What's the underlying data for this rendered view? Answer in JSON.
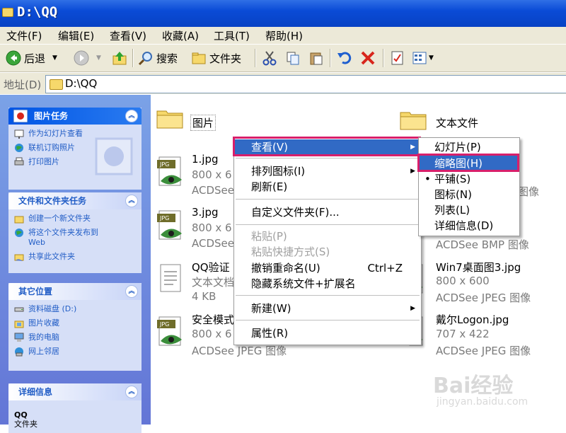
{
  "window": {
    "title": "D:\\QQ"
  },
  "menubar": [
    "文件(F)",
    "编辑(E)",
    "查看(V)",
    "收藏(A)",
    "工具(T)",
    "帮助(H)"
  ],
  "toolbar": {
    "back": "后退",
    "search": "搜索",
    "folders": "文件夹"
  },
  "address": {
    "label": "地址(D)",
    "value": "D:\\QQ"
  },
  "left_panels": {
    "picture_tasks": {
      "title": "图片任务",
      "items": [
        "作为幻灯片查看",
        "联机订购照片",
        "打印图片"
      ]
    },
    "file_tasks": {
      "title": "文件和文件夹任务",
      "items": [
        "创建一个新文件夹",
        "将这个文件夹发布到",
        "Web",
        "共享此文件夹"
      ]
    },
    "other_places": {
      "title": "其它位置",
      "items": [
        "资料磁盘 (D:)",
        "图片收藏",
        "我的电脑",
        "网上邻居"
      ]
    },
    "details": {
      "title": "详细信息",
      "name": "QQ",
      "type": "文件夹"
    }
  },
  "files": [
    {
      "name": "图片"
    },
    {
      "name": "文本文件"
    },
    {
      "name": "1.jpg",
      "size": "800 x 6",
      "type": "ACDSee"
    },
    {
      "name": "3.jpg",
      "size": "800 x 6",
      "type": "ACDSee"
    },
    {
      "name": "QQ验证",
      "size": "文本文档",
      "type": "4 KB"
    },
    {
      "name": "安全模式",
      "size": "800 x 6",
      "type": "ACDSee JPEG 图像"
    },
    {
      "col2_type1": "图像"
    },
    {
      "col2_type2": "ACDSee BMP 图像"
    },
    {
      "name": "Win7桌面图3.jpg",
      "size": "800 x 600",
      "type": "ACDSee JPEG 图像"
    },
    {
      "name": "戴尔Logon.jpg",
      "size": "707 x 422",
      "type": "ACDSee JPEG 图像"
    }
  ],
  "context_menu": {
    "view": "查看(V)",
    "arrange": "排列图标(I)",
    "refresh": "刷新(E)",
    "customize": "自定义文件夹(F)...",
    "paste": "粘贴(P)",
    "paste_shortcut": "粘贴快捷方式(S)",
    "undo_rename": "撤销重命名(U)",
    "undo_shortcut": "Ctrl+Z",
    "hide_ext": "隐藏系统文件+扩展名",
    "new": "新建(W)",
    "properties": "属性(R)"
  },
  "view_submenu": {
    "filmstrip": "幻灯片(P)",
    "thumbnails": "缩略图(H)",
    "tiles": "平铺(S)",
    "icons": "图标(N)",
    "list": "列表(L)",
    "details": "详细信息(D)",
    "bullet": "•"
  },
  "watermark": {
    "logo": "Bai经验",
    "url": "jingyan.baidu.com"
  }
}
